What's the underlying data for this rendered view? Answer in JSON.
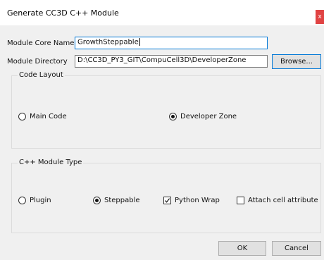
{
  "window": {
    "title": "Generate CC3D C++ Module",
    "close_glyph": "x"
  },
  "form": {
    "core_name_label": "Module Core Name",
    "core_name_value": "GrowthSteppable",
    "directory_label": "Module Directory",
    "directory_value": "D:\\CC3D_PY3_GIT\\CompuCell3D\\DeveloperZone",
    "browse_label": "Browse..."
  },
  "code_layout": {
    "title": "Code Layout",
    "options": [
      {
        "label": "Main Code",
        "selected": false
      },
      {
        "label": "Developer Zone",
        "selected": true
      }
    ]
  },
  "module_type": {
    "title": "C++ Module Type",
    "options": [
      {
        "label": "Plugin",
        "selected": false
      },
      {
        "label": "Steppable",
        "selected": true
      }
    ],
    "checkboxes": [
      {
        "label": "Python Wrap",
        "checked": true
      },
      {
        "label": "Attach cell attribute",
        "checked": false
      }
    ]
  },
  "buttons": {
    "ok": "OK",
    "cancel": "Cancel"
  },
  "colors": {
    "close": "#e04343",
    "focus": "#0078d7"
  }
}
